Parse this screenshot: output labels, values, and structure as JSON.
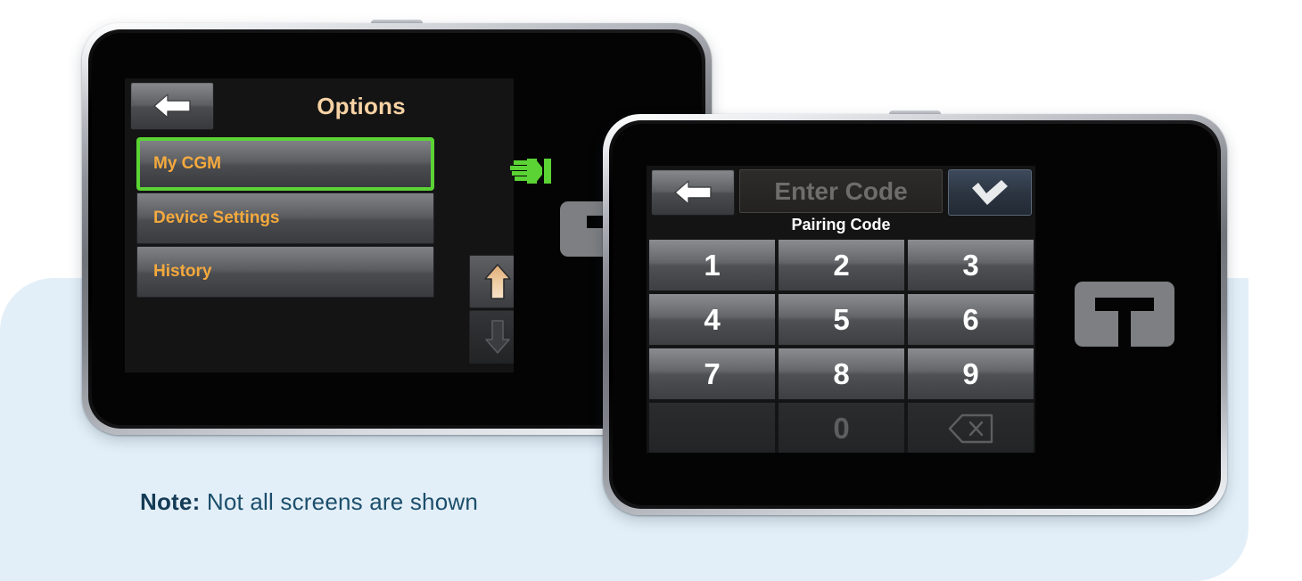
{
  "background": {
    "page_color": "#ffffff",
    "panel_color": "#e3eff8"
  },
  "note": {
    "label": "Note:",
    "text": "Not all screens are shown"
  },
  "left_device": {
    "name": "insulin-pump-options-screen",
    "screen": {
      "back_button": "back-arrow-icon",
      "title": "Options",
      "menu_items": [
        {
          "label": "My CGM",
          "selected": true
        },
        {
          "label": "Device Settings",
          "selected": false
        },
        {
          "label": "History",
          "selected": false
        }
      ],
      "scroll_up": "scroll-up-arrow",
      "scroll_down": "scroll-down-arrow",
      "highlight_color": "#5bd335",
      "menu_text_color": "#f5a93c",
      "title_color": "#f7d2a4"
    },
    "tap_indicator": "green-pointing-hand-icon",
    "logo": "tandem-t-logo"
  },
  "right_device": {
    "name": "insulin-pump-pairing-code-screen",
    "screen": {
      "back_button": "back-arrow-icon",
      "code_value": "",
      "code_placeholder": "Enter Code",
      "confirm_button": "checkmark-icon",
      "field_label": "Pairing Code",
      "keypad": [
        {
          "label": "1",
          "state": "active"
        },
        {
          "label": "2",
          "state": "active"
        },
        {
          "label": "3",
          "state": "active"
        },
        {
          "label": "4",
          "state": "active"
        },
        {
          "label": "5",
          "state": "active"
        },
        {
          "label": "6",
          "state": "active"
        },
        {
          "label": "7",
          "state": "active"
        },
        {
          "label": "8",
          "state": "active"
        },
        {
          "label": "9",
          "state": "active"
        },
        {
          "label": "",
          "state": "blank"
        },
        {
          "label": "0",
          "state": "dim"
        },
        {
          "label": "backspace-icon",
          "state": "dim-icon"
        }
      ],
      "confirm_color": "#2b3440"
    },
    "logo": "tandem-t-logo"
  }
}
